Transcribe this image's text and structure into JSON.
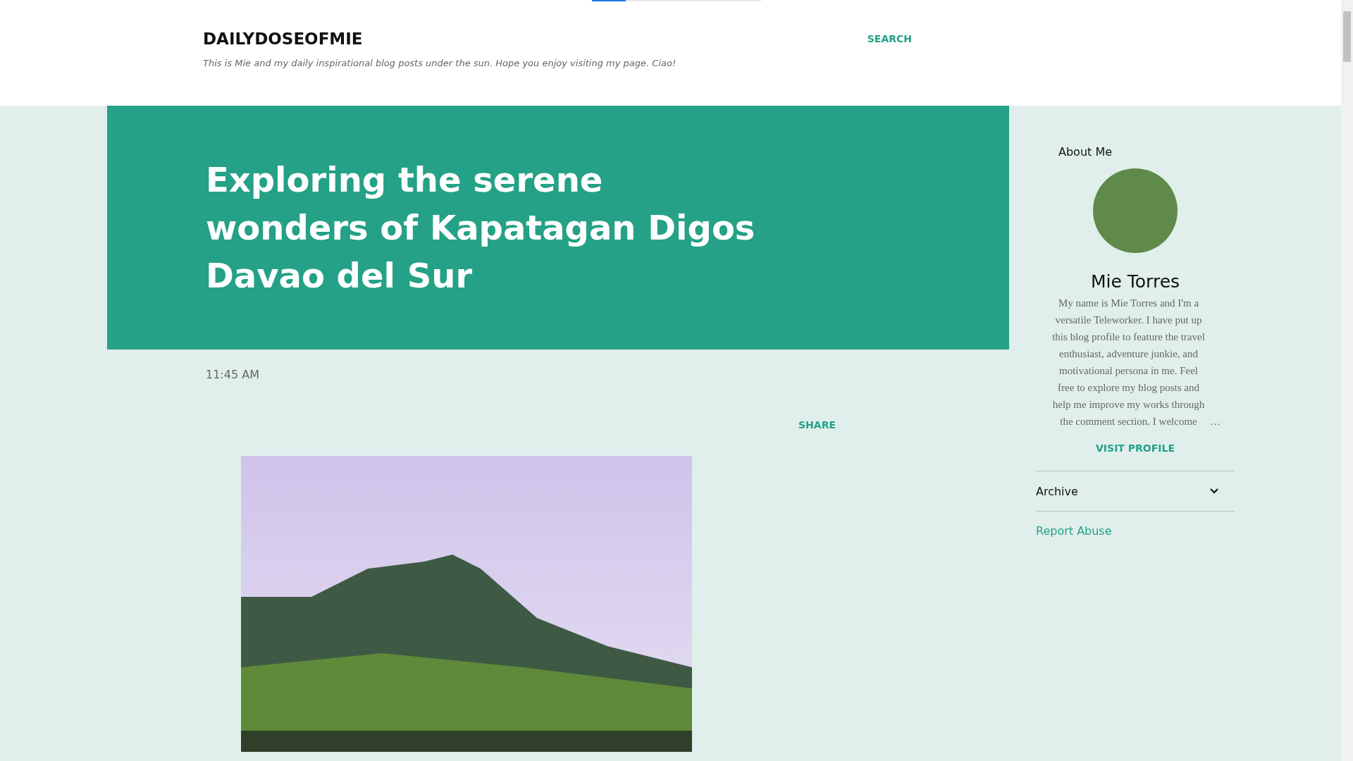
{
  "loading_bar": {
    "level": 0.2
  },
  "header": {
    "blog_title": "DAILYDOSEOFMIE",
    "search": "SEARCH",
    "tagline": "This is Mie and my daily inspirational blog posts under the sun. Hope you enjoy visiting my page. Ciao!"
  },
  "post": {
    "title": "Exploring the serene wonders of Kapatagan Digos Davao del Sur",
    "time": "11:45 AM",
    "share": "SHARE"
  },
  "sidebar": {
    "heading": "About Me",
    "name": "Mie Torres",
    "bio": "My name is Mie Torres and I'm a versatile Teleworker. I have put up this blog profile to feature the travel enthusiast, adventure junkie, and motivational persona in me. Feel free to explore my blog posts and help me improve my works through the comment section. I welcome",
    "more": "…",
    "visit_profile": "VISIT PROFILE",
    "archive": {
      "label": "Archive",
      "expanded": false
    },
    "report_abuse": "Report Abuse"
  }
}
